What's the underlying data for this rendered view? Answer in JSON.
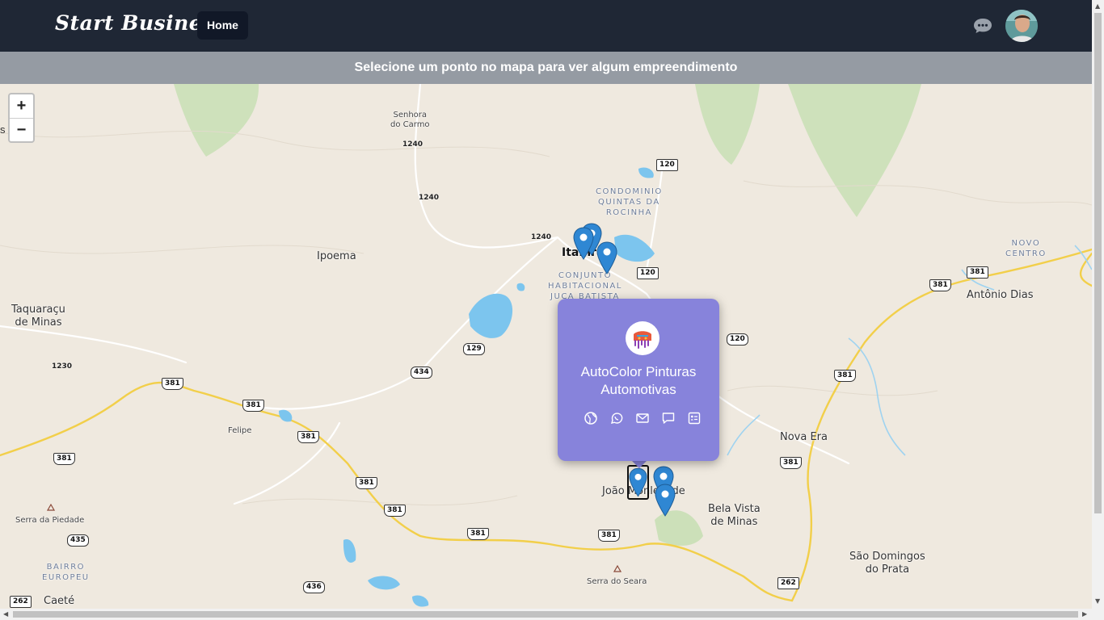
{
  "navbar": {
    "brand": "Start Business",
    "home_label": "Home",
    "bg_color": "#1f2735"
  },
  "infobar": {
    "message": "Selecione um ponto no mapa para ver algum empreendimento"
  },
  "map": {
    "zoom_in": "+",
    "zoom_out": "−",
    "left_cut_label": "s",
    "places": {
      "senhora_l1": "Senhora",
      "senhora_l2": "do Carmo",
      "condominio_l1": "CONDOMINIO",
      "condominio_l2": "QUINTAS DA",
      "condominio_l3": "ROCINHA",
      "ipoema": "Ipoema",
      "itabira": "Itabira",
      "conjunto_l1": "CONJUNTO",
      "conjunto_l2": "HABITACIONAL",
      "conjunto_l3": "JUCA BATISTA",
      "novo_centro_l1": "NOVO",
      "novo_centro_l2": "CENTRO",
      "antonio_dias": "Antônio Dias",
      "taquaracu_l1": "Taquaraçu",
      "taquaracu_l2": "de Minas",
      "felipe": "Felipe",
      "nova_era": "Nova Era",
      "joao_monlevade": "João Monlevade",
      "bela_vista_l1": "Bela Vista",
      "bela_vista_l2": "de Minas",
      "serra_piedade": "Serra da Piedade",
      "bairro_l1": "BAIRRO",
      "bairro_l2": "EUROPEU",
      "serra_seara": "Serra do Seara",
      "sao_domingos_l1": "São Domingos",
      "sao_domingos_l2": "do Prata",
      "caete": "Caeté"
    },
    "elevations": [
      "1240",
      "1240",
      "1240",
      "1230"
    ],
    "shields": [
      "120",
      "120",
      "120",
      "120",
      "381",
      "381",
      "381",
      "381",
      "381",
      "381",
      "381",
      "381",
      "381",
      "381",
      "381",
      "129",
      "434",
      "435",
      "436",
      "262",
      "262",
      "381"
    ]
  },
  "popup": {
    "title": "AutoColor Pinturas Automotivas",
    "bg_color": "#8783db",
    "icons": [
      "globe-icon",
      "whatsapp-icon",
      "mail-icon",
      "chat-icon",
      "contact-card-icon"
    ]
  }
}
